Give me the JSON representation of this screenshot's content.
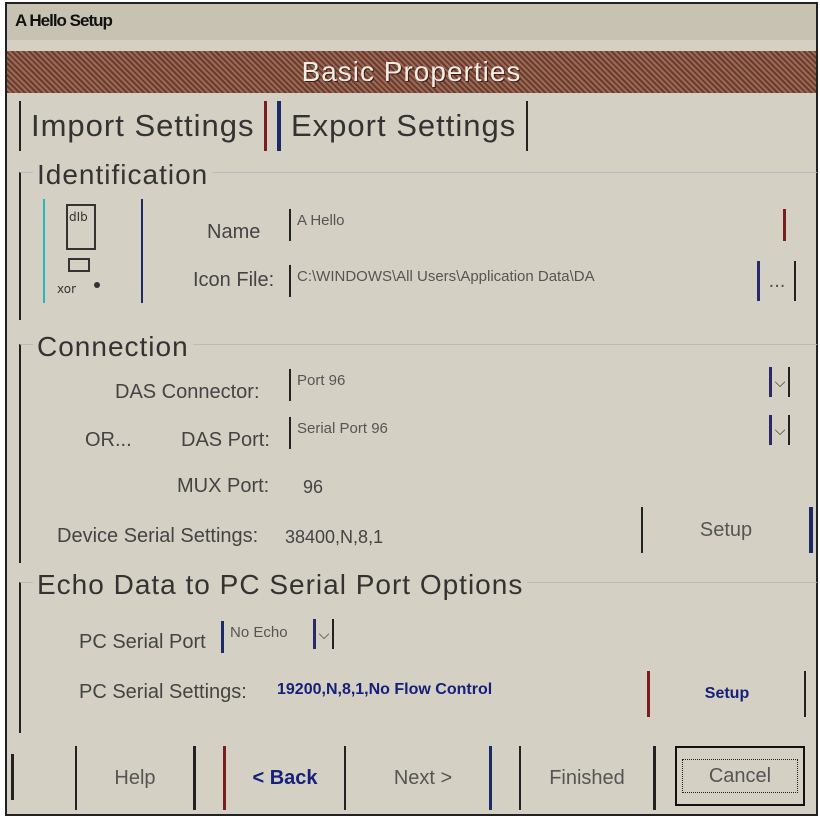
{
  "window": {
    "title": "A Hello Setup"
  },
  "header": {
    "title": "Basic Properties"
  },
  "tabs": [
    {
      "label": "Import Settings"
    },
    {
      "label": "Export Settings"
    }
  ],
  "identification": {
    "legend": "Identification",
    "name_label": "Name",
    "name_value": "A Hello",
    "icon_file_label": "Icon File:",
    "icon_file_value": "C:\\WINDOWS\\All Users\\Application Data\\DA",
    "browse_label": "..."
  },
  "connection": {
    "legend": "Connection",
    "das_connector_label": "DAS Connector:",
    "das_connector_value": "Port 96",
    "or_label": "OR...",
    "das_port_label": "DAS Port:",
    "das_port_value": "Serial Port 96",
    "mux_port_label": "MUX Port:",
    "mux_port_value": "96",
    "serial_settings_label": "Device Serial Settings:",
    "serial_settings_value": "38400,N,8,1",
    "setup_label": "Setup"
  },
  "echo": {
    "legend": "Echo Data to PC Serial Port Options",
    "pc_serial_port_label": "PC Serial Port",
    "pc_serial_port_value": "No Echo",
    "pc_serial_settings_label": "PC Serial Settings:",
    "pc_serial_settings_value": "19200,N,8,1,No Flow Control",
    "setup_label": "Setup"
  },
  "footer": {
    "help": "Help",
    "back": "< Back",
    "next": "Next >",
    "finished": "Finished",
    "cancel": "Cancel"
  },
  "colors": {
    "header_bg": "#7a4636",
    "accent_blue": "#16207a",
    "accent_red": "#7a1d1d"
  }
}
